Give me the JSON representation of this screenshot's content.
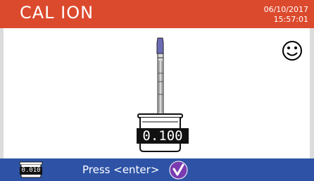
{
  "header": {
    "title": "CAL ION",
    "date": "06/10/2017",
    "time": "15:57:01"
  },
  "status": {
    "icon": "smiley-icon"
  },
  "main": {
    "standard_value": "0.100",
    "electrode_icon": "electrode-icon",
    "beaker_icon": "beaker-icon"
  },
  "footer": {
    "previous_standard": "0.010",
    "prompt": "Press <enter>",
    "confirm_icon": "checkmark-icon"
  },
  "colors": {
    "header_bg": "#dc4a2d",
    "footer_bg": "#2e53a6",
    "background": "#ffffff",
    "text_light": "#ffffff",
    "value_bg": "#111111",
    "confirm_bg": "#7a3bb0",
    "electrode_tip": "#6b6bb5"
  }
}
